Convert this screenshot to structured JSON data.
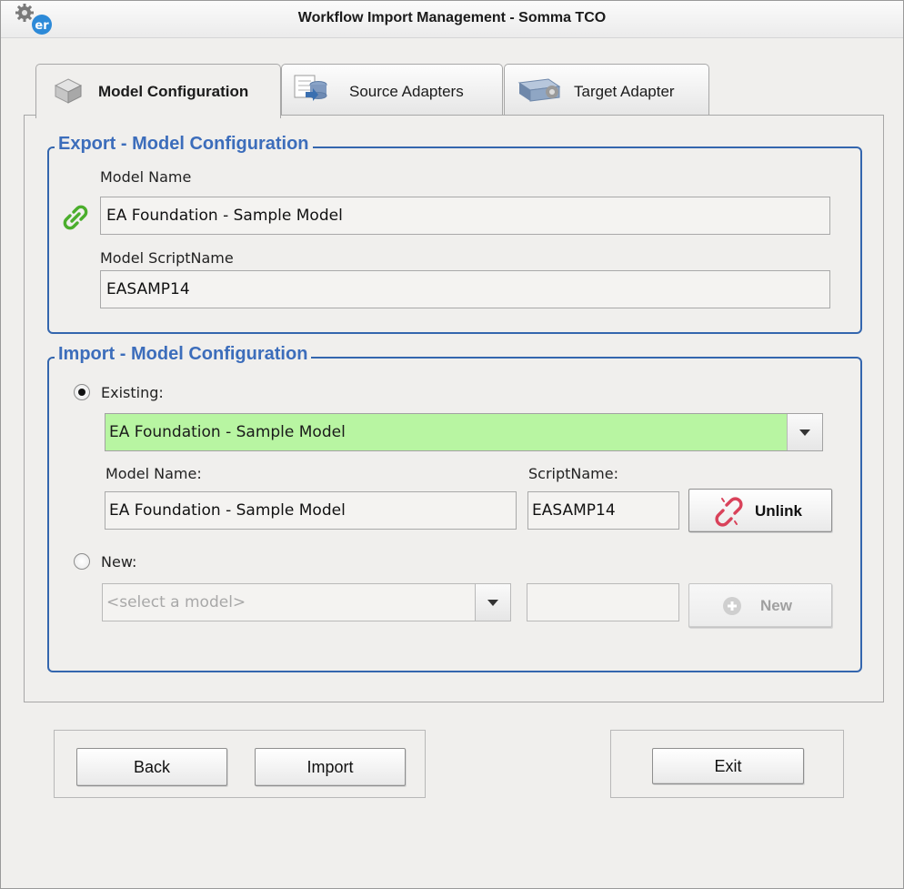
{
  "window": {
    "title": "Workflow Import Management - Somma TCO"
  },
  "tabs": [
    {
      "label": "Model Configuration",
      "icon": "cube-icon",
      "active": true
    },
    {
      "label": "Source Adapters",
      "icon": "database-icon",
      "active": false
    },
    {
      "label": "Target Adapter",
      "icon": "network-adapter-icon",
      "active": false
    }
  ],
  "export_section": {
    "legend": "Export - Model Configuration",
    "model_name_label": "Model Name",
    "model_name_value": "EA Foundation - Sample Model",
    "script_name_label": "Model ScriptName",
    "script_name_value": "EASAMP14",
    "link_icon": "link-icon"
  },
  "import_section": {
    "legend": "Import - Model Configuration",
    "existing": {
      "label": "Existing:",
      "checked": true,
      "selected_model": "EA Foundation - Sample Model",
      "model_name_label": "Model Name:",
      "model_name_value": "EA Foundation - Sample Model",
      "script_name_label": "ScriptName:",
      "script_name_value": "EASAMP14",
      "unlink_label": "Unlink"
    },
    "new": {
      "label": "New:",
      "checked": false,
      "select_placeholder": "<select a model>",
      "script_value": "",
      "new_label": "New"
    }
  },
  "footer": {
    "back_label": "Back",
    "import_label": "Import",
    "exit_label": "Exit"
  },
  "colors": {
    "legend_blue": "#3c6dbb",
    "group_border": "#3466ae",
    "selected_combo_bg": "#b8f5a2",
    "link_green": "#4bae2c",
    "unlink_red": "#d9425a"
  }
}
